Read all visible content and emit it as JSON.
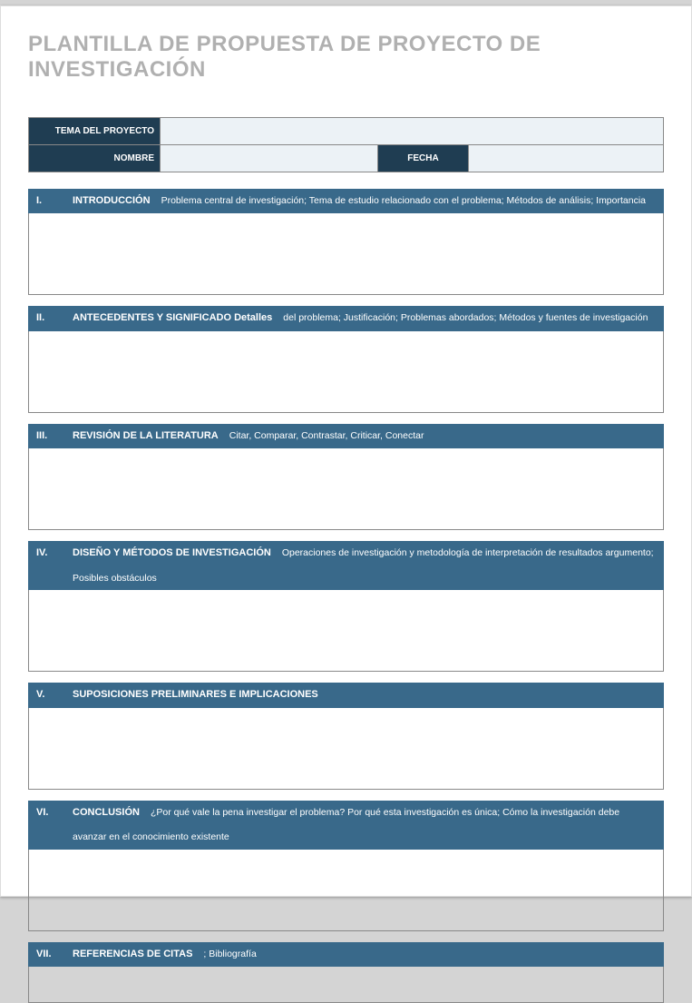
{
  "title": "PLANTILLA DE PROPUESTA DE PROYECTO DE INVESTIGACIÓN",
  "header": {
    "topic_label": "TEMA DEL PROYECTO",
    "name_label": "NOMBRE",
    "date_label": "FECHA"
  },
  "sections": [
    {
      "roman": "I.",
      "heading": "INTRODUCCIÓN",
      "hint": "Problema central de investigación; Tema de estudio relacionado con el problema; Métodos de análisis; Importancia",
      "hint2": ""
    },
    {
      "roman": "II.",
      "heading": "ANTECEDENTES Y SIGNIFICADO Detalles",
      "hint": "del problema; Justificación; Problemas abordados; Métodos y fuentes de investigación",
      "hint2": ""
    },
    {
      "roman": "III.",
      "heading": "REVISIÓN DE LA LITERATURA",
      "hint": "Citar, Comparar, Contrastar, Criticar, Conectar",
      "hint2": ""
    },
    {
      "roman": "IV.",
      "heading": "DISEÑO Y MÉTODOS DE INVESTIGACIÓN",
      "hint": "Operaciones de investigación y metodología de interpretación de resultados argumento;",
      "hint2": "Posibles obstáculos"
    },
    {
      "roman": "V.",
      "heading": "SUPOSICIONES PRELIMINARES E IMPLICACIONES",
      "hint": "",
      "hint2": ""
    },
    {
      "roman": "VI.",
      "heading": "CONCLUSIÓN",
      "hint": "¿Por qué vale la pena investigar el problema? Por qué esta investigación es única; Cómo la investigación debe",
      "hint2": "avanzar en el conocimiento existente"
    },
    {
      "roman": "VII.",
      "heading": "REFERENCIAS DE CITAS",
      "hint": "; Bibliografía",
      "hint2": ""
    }
  ]
}
